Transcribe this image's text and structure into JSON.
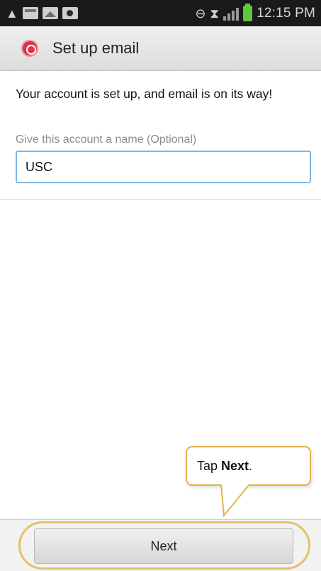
{
  "status_bar": {
    "time": "12:15 PM",
    "icons": [
      "warning-icon",
      "email-notification-icon",
      "gallery-icon",
      "video-icon",
      "sync-icon",
      "wifi-icon",
      "signal-icon",
      "battery-icon"
    ]
  },
  "title_bar": {
    "app_icon": "email-app-icon",
    "title": "Set up email"
  },
  "content": {
    "message": "Your account is set up, and email is on its way!",
    "name_field": {
      "label": "Give this account a name (Optional)",
      "value": "USC"
    }
  },
  "callout": {
    "prefix": "Tap ",
    "bold": "Next",
    "suffix": "."
  },
  "bottom_bar": {
    "next_label": "Next"
  },
  "colors": {
    "highlight": "#e4c16a",
    "input_focus": "#7fb7e4",
    "app_icon": "#d6354a"
  }
}
